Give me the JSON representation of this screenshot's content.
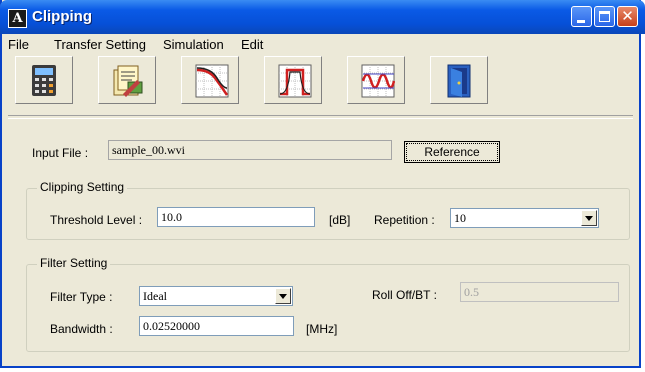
{
  "window": {
    "title": "Clipping"
  },
  "menu": [
    "File",
    "Transfer Setting",
    "Simulation",
    "Edit"
  ],
  "toolbar": [
    {
      "icon": "calculator-icon"
    },
    {
      "icon": "document-edit-icon"
    },
    {
      "icon": "curve-graph-icon"
    },
    {
      "icon": "filter-graph-icon"
    },
    {
      "icon": "waveform-graph-icon"
    },
    {
      "icon": "exit-door-icon"
    }
  ],
  "input_file": {
    "label": "Input File :",
    "value": "sample_00.wvi",
    "reference_label": "Reference"
  },
  "clipping": {
    "legend": "Clipping Setting",
    "threshold_label": "Threshold Level :",
    "threshold_value": "10.0",
    "threshold_unit": "[dB]",
    "repetition_label": "Repetition :",
    "repetition_value": "10"
  },
  "filter": {
    "legend": "Filter Setting",
    "type_label": "Filter Type :",
    "type_value": "Ideal",
    "rolloff_label": "Roll Off/BT :",
    "rolloff_value": "0.5",
    "bandwidth_label": "Bandwidth :",
    "bandwidth_value": "0.02520000",
    "bandwidth_unit": "[MHz]"
  }
}
